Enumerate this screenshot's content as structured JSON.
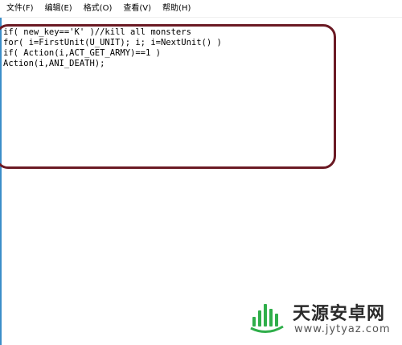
{
  "menubar": {
    "items": [
      {
        "label": "文件(F)"
      },
      {
        "label": "编辑(E)"
      },
      {
        "label": "格式(O)"
      },
      {
        "label": "查看(V)"
      },
      {
        "label": "帮助(H)"
      }
    ]
  },
  "editor": {
    "lines": [
      "if( new_key=='K' )//kill all monsters",
      "for( i=FirstUnit(U_UNIT); i; i=NextUnit() )",
      "if( Action(i,ACT_GET_ARMY)==1 )",
      "Action(i,ANI_DEATH);"
    ]
  },
  "annotation": {
    "color": "#6b1a24"
  },
  "watermark": {
    "title": "天源安卓网",
    "url": "www.jytyaz.com",
    "logo_icon": "green-bars-logo-icon",
    "logo_color": "#2fae4a"
  }
}
